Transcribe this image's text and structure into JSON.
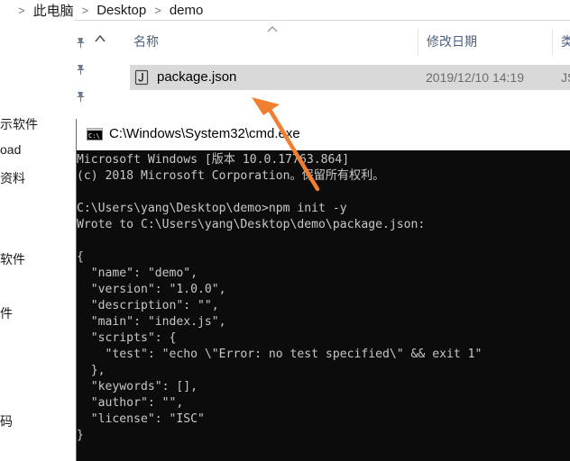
{
  "breadcrumb": {
    "items": [
      "此电脑",
      "Desktop",
      "demo"
    ]
  },
  "nav": {
    "items": [
      "示软件",
      "oad",
      "资料",
      "软件",
      "件",
      "码"
    ]
  },
  "columns": {
    "name": "名称",
    "modified": "修改日期",
    "type_partial": "类"
  },
  "file": {
    "name": "package.json",
    "modified": "2019/12/10 14:19",
    "type_partial": "JS"
  },
  "cmd": {
    "title": "C:\\Windows\\System32\\cmd.exe",
    "lines": [
      "Microsoft Windows [版本 10.0.17763.864]",
      "(c) 2018 Microsoft Corporation。保留所有权利。",
      "",
      "C:\\Users\\yang\\Desktop\\demo>npm init -y",
      "Wrote to C:\\Users\\yang\\Desktop\\demo\\package.json:",
      "",
      "{",
      "  \"name\": \"demo\",",
      "  \"version\": \"1.0.0\",",
      "  \"description\": \"\",",
      "  \"main\": \"index.js\",",
      "  \"scripts\": {",
      "    \"test\": \"echo \\\"Error: no test specified\\\" && exit 1\"",
      "  },",
      "  \"keywords\": [],",
      "  \"author\": \"\",",
      "  \"license\": \"ISC\"",
      "}"
    ]
  },
  "colors": {
    "accent_arrow": "#f07f2f",
    "selection": "#d9d9d9",
    "console_bg": "#0c0c0c",
    "console_text": "#c8c8c8"
  },
  "icons": [
    "chevron-right-icon",
    "pin-icon",
    "chevron-up-icon",
    "sort-up-icon",
    "json-file-icon",
    "cmd-icon",
    "annotation-arrow"
  ]
}
